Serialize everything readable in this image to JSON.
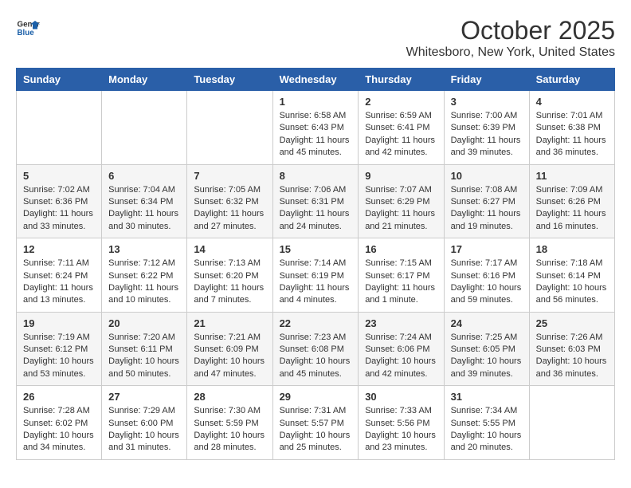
{
  "header": {
    "logo_line1": "General",
    "logo_line2": "Blue",
    "month": "October 2025",
    "location": "Whitesboro, New York, United States"
  },
  "weekdays": [
    "Sunday",
    "Monday",
    "Tuesday",
    "Wednesday",
    "Thursday",
    "Friday",
    "Saturday"
  ],
  "weeks": [
    [
      {
        "day": "",
        "info": ""
      },
      {
        "day": "",
        "info": ""
      },
      {
        "day": "",
        "info": ""
      },
      {
        "day": "1",
        "info": "Sunrise: 6:58 AM\nSunset: 6:43 PM\nDaylight: 11 hours\nand 45 minutes."
      },
      {
        "day": "2",
        "info": "Sunrise: 6:59 AM\nSunset: 6:41 PM\nDaylight: 11 hours\nand 42 minutes."
      },
      {
        "day": "3",
        "info": "Sunrise: 7:00 AM\nSunset: 6:39 PM\nDaylight: 11 hours\nand 39 minutes."
      },
      {
        "day": "4",
        "info": "Sunrise: 7:01 AM\nSunset: 6:38 PM\nDaylight: 11 hours\nand 36 minutes."
      }
    ],
    [
      {
        "day": "5",
        "info": "Sunrise: 7:02 AM\nSunset: 6:36 PM\nDaylight: 11 hours\nand 33 minutes."
      },
      {
        "day": "6",
        "info": "Sunrise: 7:04 AM\nSunset: 6:34 PM\nDaylight: 11 hours\nand 30 minutes."
      },
      {
        "day": "7",
        "info": "Sunrise: 7:05 AM\nSunset: 6:32 PM\nDaylight: 11 hours\nand 27 minutes."
      },
      {
        "day": "8",
        "info": "Sunrise: 7:06 AM\nSunset: 6:31 PM\nDaylight: 11 hours\nand 24 minutes."
      },
      {
        "day": "9",
        "info": "Sunrise: 7:07 AM\nSunset: 6:29 PM\nDaylight: 11 hours\nand 21 minutes."
      },
      {
        "day": "10",
        "info": "Sunrise: 7:08 AM\nSunset: 6:27 PM\nDaylight: 11 hours\nand 19 minutes."
      },
      {
        "day": "11",
        "info": "Sunrise: 7:09 AM\nSunset: 6:26 PM\nDaylight: 11 hours\nand 16 minutes."
      }
    ],
    [
      {
        "day": "12",
        "info": "Sunrise: 7:11 AM\nSunset: 6:24 PM\nDaylight: 11 hours\nand 13 minutes."
      },
      {
        "day": "13",
        "info": "Sunrise: 7:12 AM\nSunset: 6:22 PM\nDaylight: 11 hours\nand 10 minutes."
      },
      {
        "day": "14",
        "info": "Sunrise: 7:13 AM\nSunset: 6:20 PM\nDaylight: 11 hours\nand 7 minutes."
      },
      {
        "day": "15",
        "info": "Sunrise: 7:14 AM\nSunset: 6:19 PM\nDaylight: 11 hours\nand 4 minutes."
      },
      {
        "day": "16",
        "info": "Sunrise: 7:15 AM\nSunset: 6:17 PM\nDaylight: 11 hours\nand 1 minute."
      },
      {
        "day": "17",
        "info": "Sunrise: 7:17 AM\nSunset: 6:16 PM\nDaylight: 10 hours\nand 59 minutes."
      },
      {
        "day": "18",
        "info": "Sunrise: 7:18 AM\nSunset: 6:14 PM\nDaylight: 10 hours\nand 56 minutes."
      }
    ],
    [
      {
        "day": "19",
        "info": "Sunrise: 7:19 AM\nSunset: 6:12 PM\nDaylight: 10 hours\nand 53 minutes."
      },
      {
        "day": "20",
        "info": "Sunrise: 7:20 AM\nSunset: 6:11 PM\nDaylight: 10 hours\nand 50 minutes."
      },
      {
        "day": "21",
        "info": "Sunrise: 7:21 AM\nSunset: 6:09 PM\nDaylight: 10 hours\nand 47 minutes."
      },
      {
        "day": "22",
        "info": "Sunrise: 7:23 AM\nSunset: 6:08 PM\nDaylight: 10 hours\nand 45 minutes."
      },
      {
        "day": "23",
        "info": "Sunrise: 7:24 AM\nSunset: 6:06 PM\nDaylight: 10 hours\nand 42 minutes."
      },
      {
        "day": "24",
        "info": "Sunrise: 7:25 AM\nSunset: 6:05 PM\nDaylight: 10 hours\nand 39 minutes."
      },
      {
        "day": "25",
        "info": "Sunrise: 7:26 AM\nSunset: 6:03 PM\nDaylight: 10 hours\nand 36 minutes."
      }
    ],
    [
      {
        "day": "26",
        "info": "Sunrise: 7:28 AM\nSunset: 6:02 PM\nDaylight: 10 hours\nand 34 minutes."
      },
      {
        "day": "27",
        "info": "Sunrise: 7:29 AM\nSunset: 6:00 PM\nDaylight: 10 hours\nand 31 minutes."
      },
      {
        "day": "28",
        "info": "Sunrise: 7:30 AM\nSunset: 5:59 PM\nDaylight: 10 hours\nand 28 minutes."
      },
      {
        "day": "29",
        "info": "Sunrise: 7:31 AM\nSunset: 5:57 PM\nDaylight: 10 hours\nand 25 minutes."
      },
      {
        "day": "30",
        "info": "Sunrise: 7:33 AM\nSunset: 5:56 PM\nDaylight: 10 hours\nand 23 minutes."
      },
      {
        "day": "31",
        "info": "Sunrise: 7:34 AM\nSunset: 5:55 PM\nDaylight: 10 hours\nand 20 minutes."
      },
      {
        "day": "",
        "info": ""
      }
    ]
  ]
}
